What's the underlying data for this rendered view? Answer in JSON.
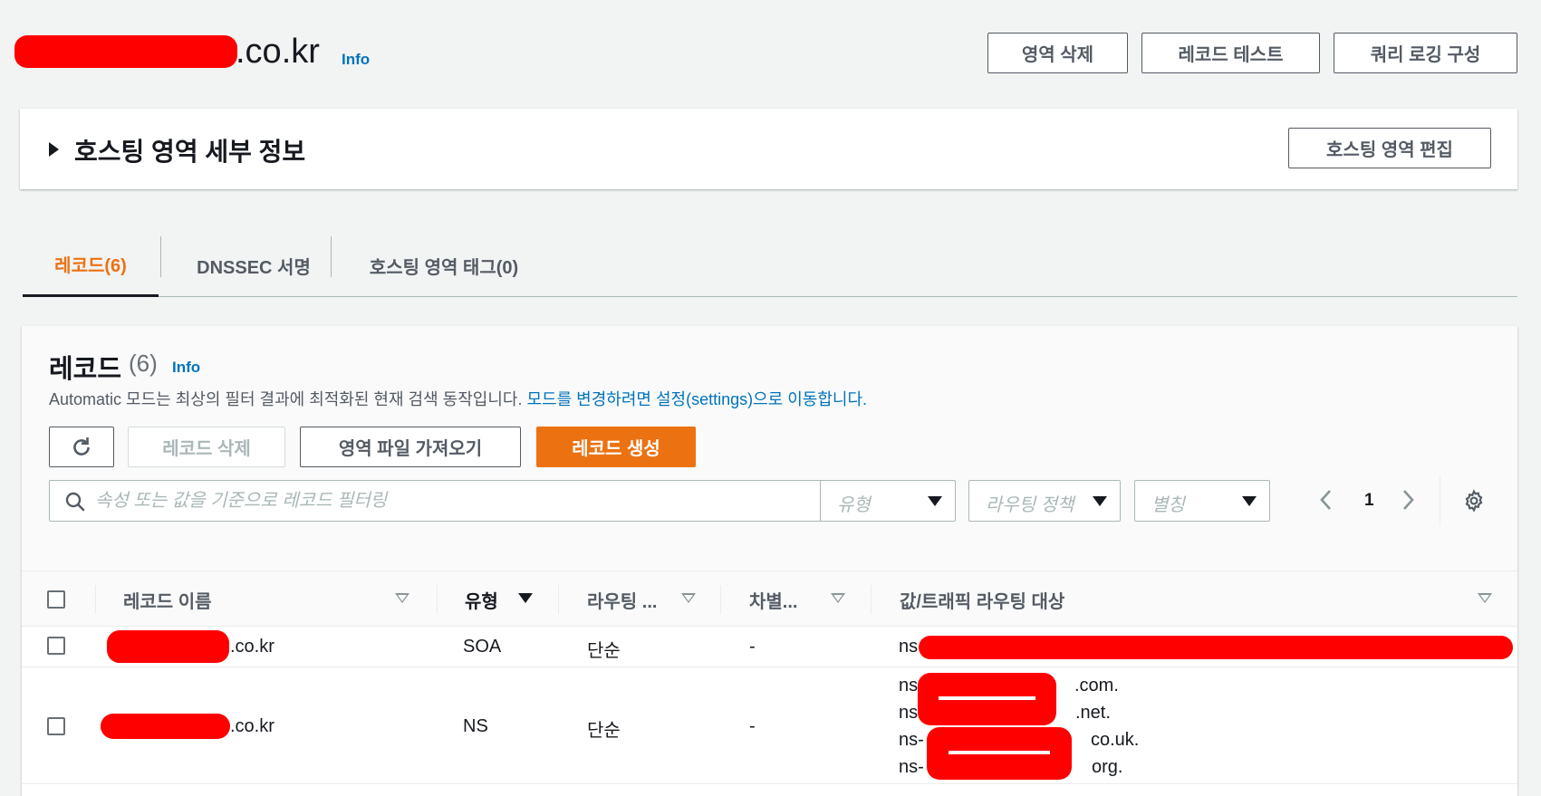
{
  "header": {
    "domain_suffix": ".co.kr",
    "info": "Info",
    "buttons": {
      "delete_zone": "영역 삭제",
      "test_record": "레코드 테스트",
      "query_logging": "쿼리 로깅 구성"
    }
  },
  "details": {
    "title": "호스팅 영역 세부 정보",
    "edit_button": "호스팅 영역 편집"
  },
  "tabs": [
    {
      "label": "레코드(6)",
      "active": true
    },
    {
      "label": "DNSSEC 서명",
      "active": false
    },
    {
      "label": "호스팅 영역 태그(0)",
      "active": false
    }
  ],
  "records": {
    "title": "레코드",
    "count": "(6)",
    "info": "Info",
    "description": "Automatic 모드는 최상의 필터 결과에 최적화된 현재 검색 동작입니다.",
    "description_link": "모드를 변경하려면 설정(settings)으로 이동합니다.",
    "actions": {
      "refresh": "refresh-icon",
      "delete": "레코드 삭제",
      "import": "영역 파일 가져오기",
      "create": "레코드 생성"
    },
    "search_placeholder": "속성 또는 값을 기준으로 레코드 필터링",
    "filters": {
      "type": "유형",
      "routing": "라우팅 정책",
      "alias": "별칭"
    },
    "page": "1",
    "columns": {
      "name": "레코드 이름",
      "type": "유형",
      "routing": "라우팅 ...",
      "differentiator": "차별...",
      "value": "값/트래픽 라우팅 대상"
    },
    "rows": [
      {
        "name_suffix": ".co.kr",
        "type": "SOA",
        "routing": "단순",
        "differentiator": "-",
        "value_prefix": "ns"
      },
      {
        "name_suffix": ".co.kr",
        "type": "NS",
        "routing": "단순",
        "differentiator": "-",
        "values": [
          {
            "prefix": "ns",
            "suffix": ".com."
          },
          {
            "prefix": "ns",
            "suffix": ".net."
          },
          {
            "prefix": "ns-",
            "suffix": "co.uk."
          },
          {
            "prefix": "ns-",
            "suffix": "org."
          }
        ]
      }
    ]
  },
  "colors": {
    "accent": "#ec7211",
    "link": "#0073bb",
    "redaction": "#ff0000"
  }
}
